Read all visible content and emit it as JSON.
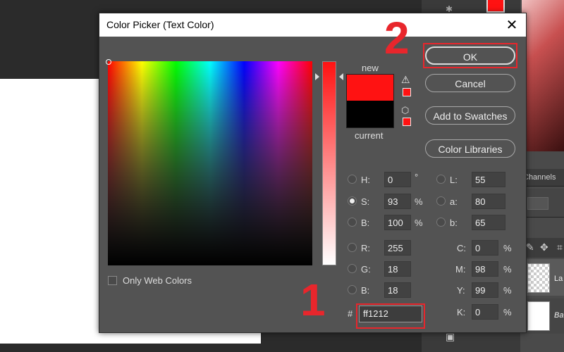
{
  "dialog": {
    "title": "Color Picker (Text Color)",
    "close_glyph": "✕",
    "only_web_colors_label": "Only Web Colors",
    "new_label": "new",
    "current_label": "current",
    "new_color": "#ff1212",
    "current_color": "#000000"
  },
  "buttons": {
    "ok": "OK",
    "cancel": "Cancel",
    "add_to_swatches": "Add to Swatches",
    "color_libraries": "Color Libraries"
  },
  "fields": {
    "H": {
      "label": "H:",
      "value": "0",
      "unit": "°"
    },
    "S": {
      "label": "S:",
      "value": "93",
      "unit": "%"
    },
    "Bv": {
      "label": "B:",
      "value": "100",
      "unit": "%"
    },
    "R": {
      "label": "R:",
      "value": "255"
    },
    "G": {
      "label": "G:",
      "value": "18"
    },
    "Bc": {
      "label": "B:",
      "value": "18"
    },
    "L": {
      "label": "L:",
      "value": "55"
    },
    "a": {
      "label": "a:",
      "value": "80"
    },
    "b": {
      "label": "b:",
      "value": "65"
    },
    "C": {
      "label": "C:",
      "value": "0",
      "unit": "%"
    },
    "M": {
      "label": "M:",
      "value": "98",
      "unit": "%"
    },
    "Y": {
      "label": "Y:",
      "value": "99",
      "unit": "%"
    },
    "K": {
      "label": "K:",
      "value": "0",
      "unit": "%"
    },
    "hex": {
      "label": "#",
      "value": "ff1212"
    },
    "selected_mode": "S"
  },
  "annotations": {
    "step1": "1",
    "step2": "2",
    "highlight_color": "#e8262c"
  },
  "background": {
    "channels_label": "Channels",
    "layer1_label": "La",
    "layer2_label": "Ba"
  },
  "icons": {
    "warning": "warning-icon",
    "cube": "cube-icon",
    "close": "close-icon"
  }
}
